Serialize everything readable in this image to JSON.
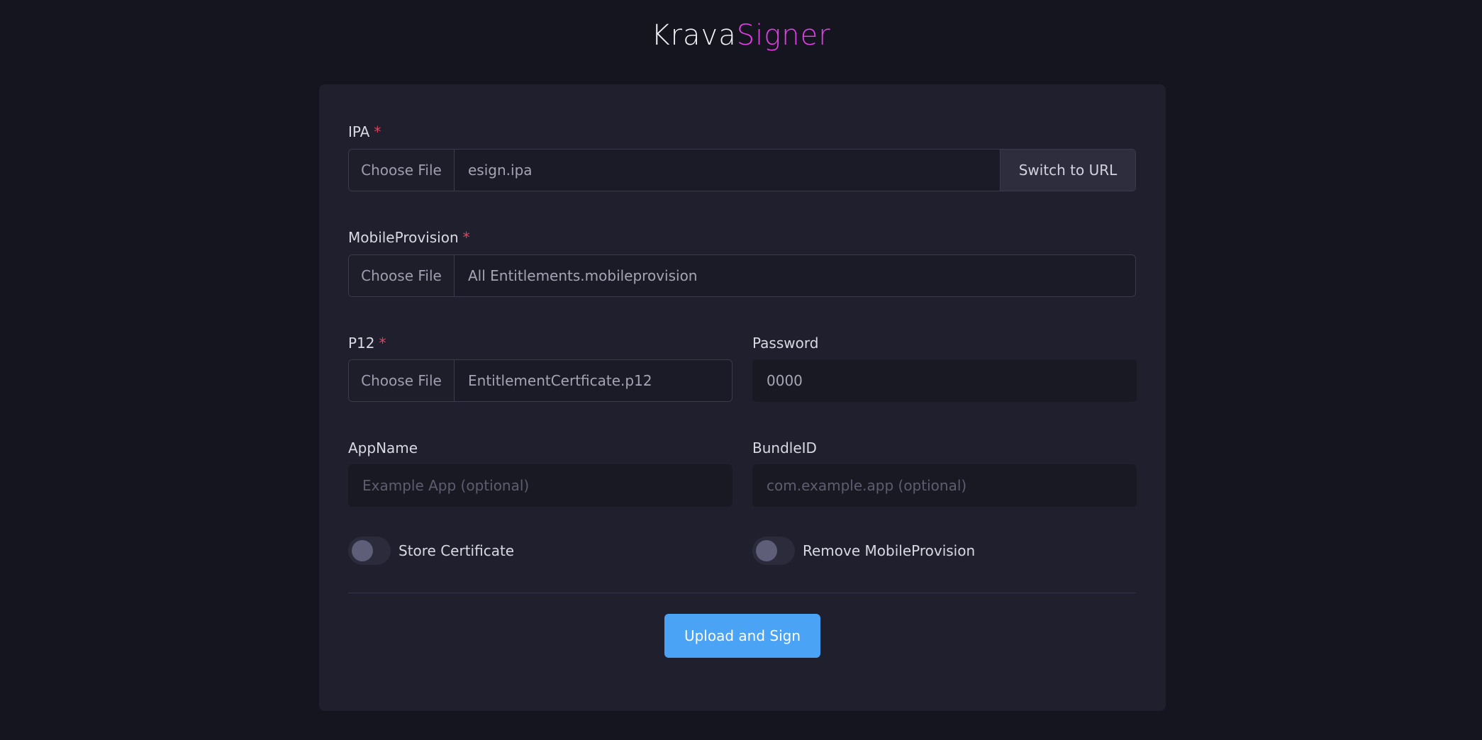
{
  "brand": {
    "part1": "Krava",
    "part2": "Signer"
  },
  "form": {
    "ipa": {
      "label": "IPA",
      "required_mark": "*",
      "choose_label": "Choose File",
      "file_name": "esign.ipa",
      "switch_label": "Switch to URL"
    },
    "mobileprovision": {
      "label": "MobileProvision",
      "required_mark": "*",
      "choose_label": "Choose File",
      "file_name": "All Entitlements.mobileprovision"
    },
    "p12": {
      "label": "P12",
      "required_mark": "*",
      "choose_label": "Choose File",
      "file_name": "EntitlementCertficate.p12"
    },
    "password": {
      "label": "Password",
      "value": "0000"
    },
    "appname": {
      "label": "AppName",
      "placeholder": "Example App (optional)"
    },
    "bundleid": {
      "label": "BundleID",
      "placeholder": "com.example.app (optional)"
    },
    "store_certificate": {
      "label": "Store Certificate",
      "checked": false
    },
    "remove_mobileprovision": {
      "label": "Remove MobileProvision",
      "checked": false
    },
    "submit_label": "Upload and Sign"
  },
  "colors": {
    "background": "#15151f",
    "card": "#1f1f2d",
    "accent": "#4aa3f5",
    "brand_pink": "#e23ee6",
    "required": "#e0445f"
  }
}
